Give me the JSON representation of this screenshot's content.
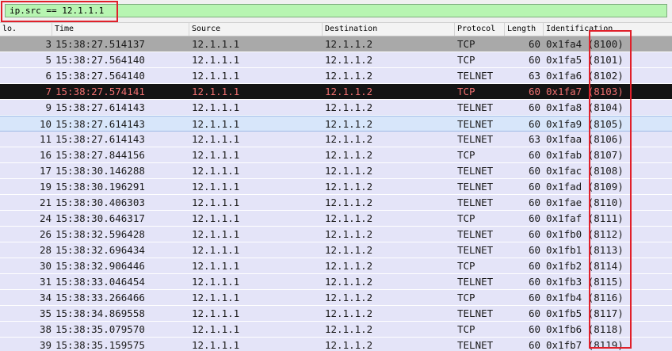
{
  "filter": {
    "value": "ip.src == 12.1.1.1"
  },
  "colors": {
    "filter_bg": "#b7f5b1",
    "row_bg": "#e4e4f8",
    "marked_bg": "#a9a9a9",
    "selected_bg": "#141414",
    "selected_fg": "#f07070",
    "annotation_red": "#e0202a"
  },
  "columns": [
    "lo.",
    "Time",
    "Source",
    "Destination",
    "Protocol",
    "Length",
    "Identification"
  ],
  "packets": [
    {
      "no": "3",
      "time": "15:38:27.514137",
      "source": "12.1.1.1",
      "destination": "12.1.1.2",
      "protocol": "TCP",
      "length": "60",
      "id": "0x1fa4 (8100)",
      "state": "marked"
    },
    {
      "no": "5",
      "time": "15:38:27.564140",
      "source": "12.1.1.1",
      "destination": "12.1.1.2",
      "protocol": "TCP",
      "length": "60",
      "id": "0x1fa5 (8101)",
      "state": "normal"
    },
    {
      "no": "6",
      "time": "15:38:27.564140",
      "source": "12.1.1.1",
      "destination": "12.1.1.2",
      "protocol": "TELNET",
      "length": "63",
      "id": "0x1fa6 (8102)",
      "state": "normal"
    },
    {
      "no": "7",
      "time": "15:38:27.574141",
      "source": "12.1.1.1",
      "destination": "12.1.1.2",
      "protocol": "TCP",
      "length": "60",
      "id": "0x1fa7 (8103)",
      "state": "selected"
    },
    {
      "no": "9",
      "time": "15:38:27.614143",
      "source": "12.1.1.1",
      "destination": "12.1.1.2",
      "protocol": "TELNET",
      "length": "60",
      "id": "0x1fa8 (8104)",
      "state": "normal"
    },
    {
      "no": "10",
      "time": "15:38:27.614143",
      "source": "12.1.1.1",
      "destination": "12.1.1.2",
      "protocol": "TELNET",
      "length": "60",
      "id": "0x1fa9 (8105)",
      "state": "focused"
    },
    {
      "no": "11",
      "time": "15:38:27.614143",
      "source": "12.1.1.1",
      "destination": "12.1.1.2",
      "protocol": "TELNET",
      "length": "63",
      "id": "0x1faa (8106)",
      "state": "normal"
    },
    {
      "no": "16",
      "time": "15:38:27.844156",
      "source": "12.1.1.1",
      "destination": "12.1.1.2",
      "protocol": "TCP",
      "length": "60",
      "id": "0x1fab (8107)",
      "state": "normal"
    },
    {
      "no": "17",
      "time": "15:38:30.146288",
      "source": "12.1.1.1",
      "destination": "12.1.1.2",
      "protocol": "TELNET",
      "length": "60",
      "id": "0x1fac (8108)",
      "state": "normal"
    },
    {
      "no": "19",
      "time": "15:38:30.196291",
      "source": "12.1.1.1",
      "destination": "12.1.1.2",
      "protocol": "TELNET",
      "length": "60",
      "id": "0x1fad (8109)",
      "state": "normal"
    },
    {
      "no": "21",
      "time": "15:38:30.406303",
      "source": "12.1.1.1",
      "destination": "12.1.1.2",
      "protocol": "TELNET",
      "length": "60",
      "id": "0x1fae (8110)",
      "state": "normal"
    },
    {
      "no": "24",
      "time": "15:38:30.646317",
      "source": "12.1.1.1",
      "destination": "12.1.1.2",
      "protocol": "TCP",
      "length": "60",
      "id": "0x1faf (8111)",
      "state": "normal"
    },
    {
      "no": "26",
      "time": "15:38:32.596428",
      "source": "12.1.1.1",
      "destination": "12.1.1.2",
      "protocol": "TELNET",
      "length": "60",
      "id": "0x1fb0 (8112)",
      "state": "normal"
    },
    {
      "no": "28",
      "time": "15:38:32.696434",
      "source": "12.1.1.1",
      "destination": "12.1.1.2",
      "protocol": "TELNET",
      "length": "60",
      "id": "0x1fb1 (8113)",
      "state": "normal"
    },
    {
      "no": "30",
      "time": "15:38:32.906446",
      "source": "12.1.1.1",
      "destination": "12.1.1.2",
      "protocol": "TCP",
      "length": "60",
      "id": "0x1fb2 (8114)",
      "state": "normal"
    },
    {
      "no": "31",
      "time": "15:38:33.046454",
      "source": "12.1.1.1",
      "destination": "12.1.1.2",
      "protocol": "TELNET",
      "length": "60",
      "id": "0x1fb3 (8115)",
      "state": "normal"
    },
    {
      "no": "34",
      "time": "15:38:33.266466",
      "source": "12.1.1.1",
      "destination": "12.1.1.2",
      "protocol": "TCP",
      "length": "60",
      "id": "0x1fb4 (8116)",
      "state": "normal"
    },
    {
      "no": "35",
      "time": "15:38:34.869558",
      "source": "12.1.1.1",
      "destination": "12.1.1.2",
      "protocol": "TELNET",
      "length": "60",
      "id": "0x1fb5 (8117)",
      "state": "normal"
    },
    {
      "no": "38",
      "time": "15:38:35.079570",
      "source": "12.1.1.1",
      "destination": "12.1.1.2",
      "protocol": "TCP",
      "length": "60",
      "id": "0x1fb6 (8118)",
      "state": "normal"
    },
    {
      "no": "39",
      "time": "15:38:35.159575",
      "source": "12.1.1.1",
      "destination": "12.1.1.2",
      "protocol": "TELNET",
      "length": "60",
      "id": "0x1fb7 (8119)",
      "state": "normal"
    }
  ]
}
